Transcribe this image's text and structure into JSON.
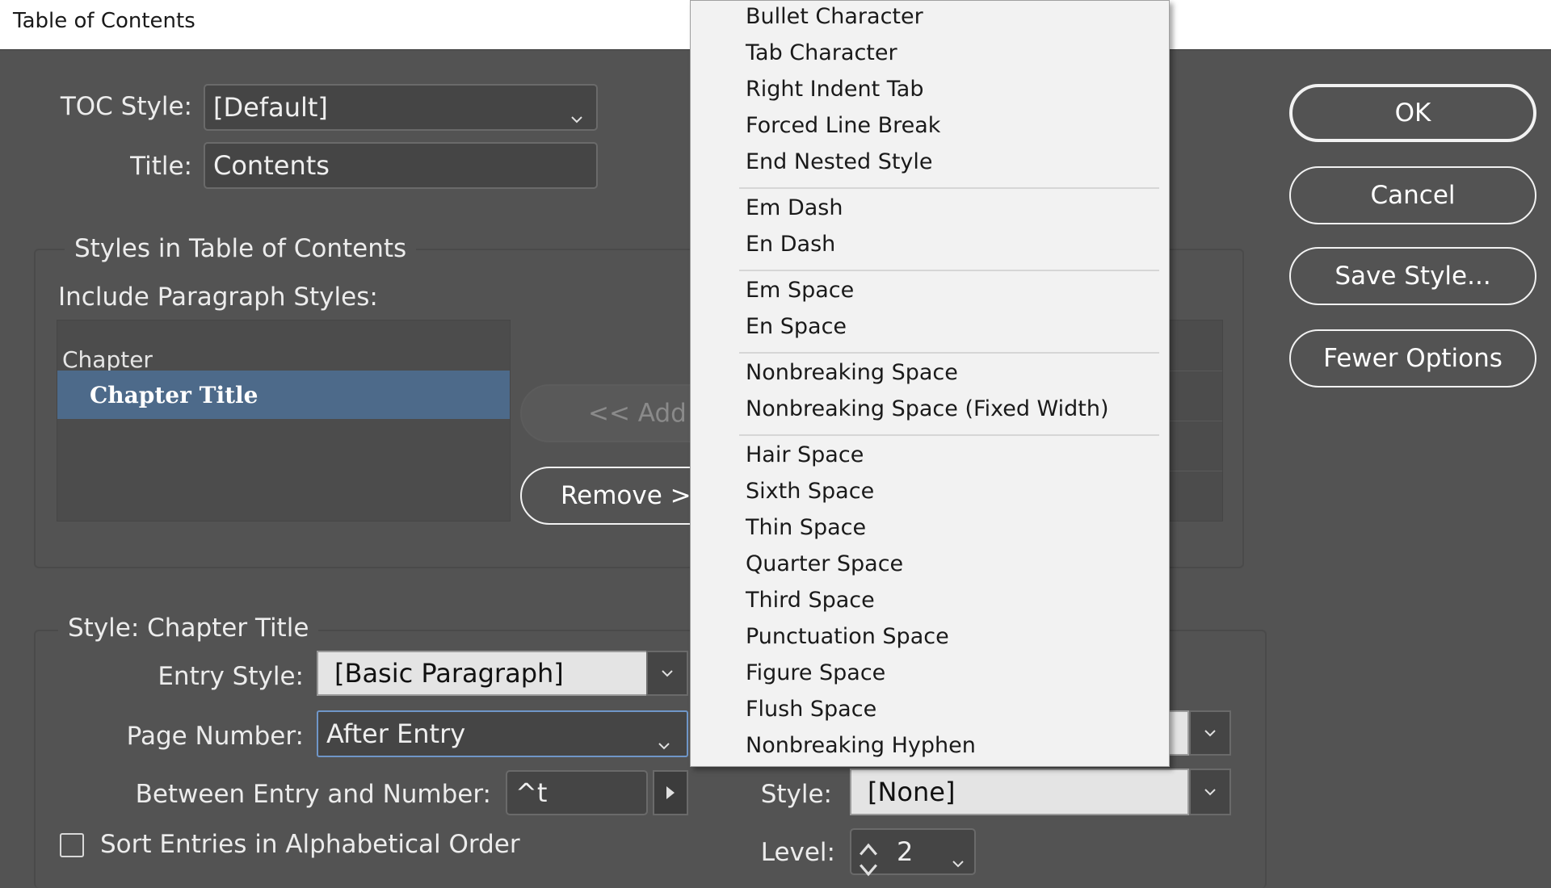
{
  "window": {
    "title": "Table of Contents"
  },
  "toc": {
    "style_label": "TOC Style:",
    "style_value": "[Default]",
    "title_label": "Title:",
    "title_value": "Contents"
  },
  "styles_group": {
    "title": "Styles in Table of Contents",
    "include_label": "Include Paragraph Styles:",
    "items": [
      {
        "label": "Chapter",
        "selected": false
      },
      {
        "label": "Chapter Title",
        "selected": true
      }
    ],
    "add_button": "<< Add",
    "remove_button": "Remove >"
  },
  "buttons": {
    "ok": "OK",
    "cancel": "Cancel",
    "save_style": "Save Style...",
    "fewer_options": "Fewer Options"
  },
  "style_group": {
    "title": "Style: Chapter Title",
    "entry_style_label": "Entry Style:",
    "entry_style_value": "[Basic Paragraph]",
    "page_number_label": "Page Number:",
    "page_number_value": "After Entry",
    "between_label": "Between Entry and Number:",
    "between_value": "^t",
    "sort_label": "Sort Entries in Alphabetical Order",
    "sort_checked": false,
    "right_style_label": "Style:",
    "right_style_value": "[None]",
    "level_label": "Level:",
    "level_value": "2"
  },
  "special_menu": {
    "groups": [
      [
        "Bullet Character",
        "Tab Character",
        "Right Indent Tab",
        "Forced Line Break",
        "End Nested Style"
      ],
      [
        "Em Dash",
        "En Dash"
      ],
      [
        "Em Space",
        "En Space"
      ],
      [
        "Nonbreaking Space",
        "Nonbreaking Space (Fixed Width)"
      ],
      [
        "Hair Space",
        "Sixth Space",
        "Thin Space",
        "Quarter Space",
        "Third Space",
        "Punctuation Space",
        "Figure Space",
        "Flush Space",
        "Nonbreaking Hyphen"
      ]
    ]
  },
  "colors": {
    "dialog_bg": "#535353",
    "selection": "#4d6a8a",
    "menu_bg": "#f2f2f2"
  }
}
